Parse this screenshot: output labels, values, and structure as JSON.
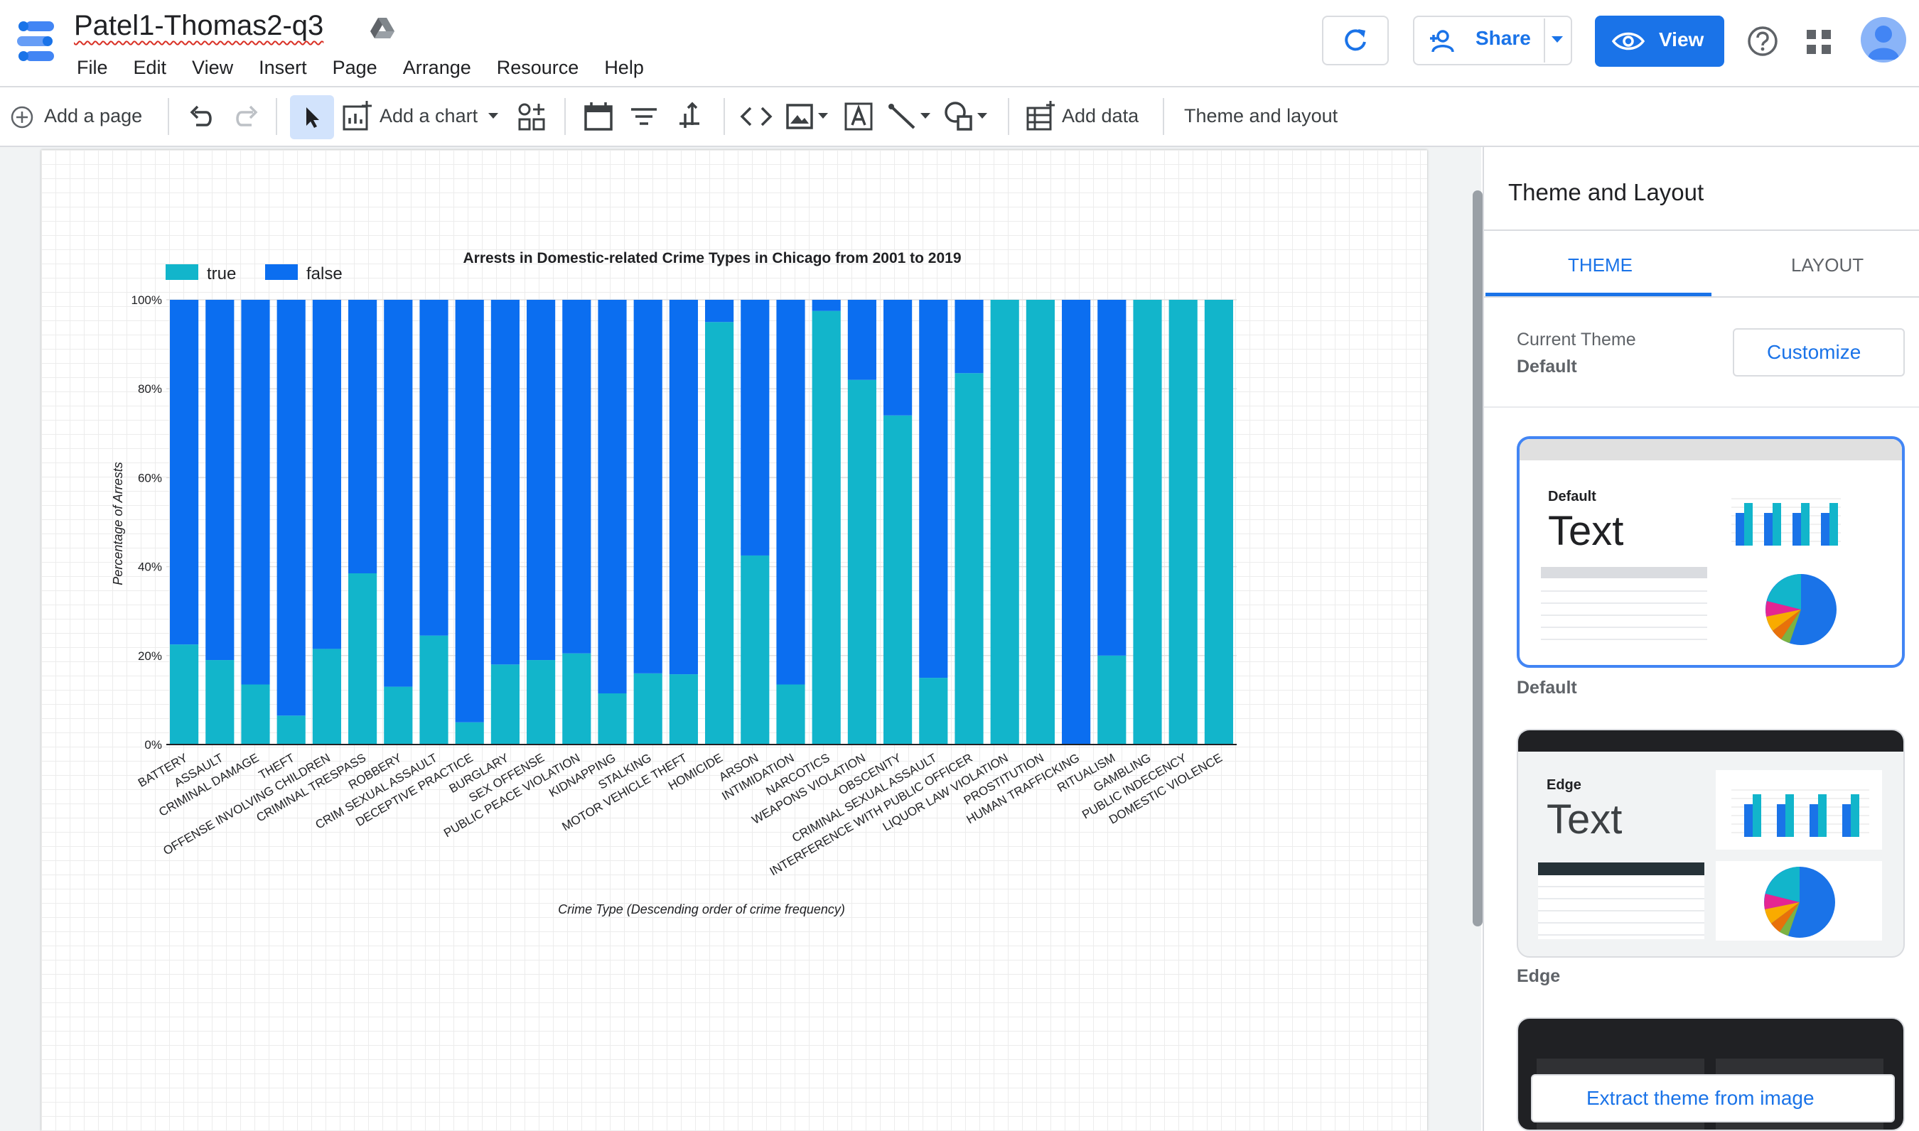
{
  "document": {
    "title": "Patel1-Thomas2-q3"
  },
  "menu": [
    "File",
    "Edit",
    "View",
    "Insert",
    "Page",
    "Arrange",
    "Resource",
    "Help"
  ],
  "header": {
    "share_label": "Share",
    "view_label": "View"
  },
  "toolbar": {
    "add_page": "Add a page",
    "add_chart": "Add a chart",
    "add_data": "Add data",
    "theme_layout": "Theme and layout"
  },
  "panel": {
    "title": "Theme and Layout",
    "tabs": [
      "THEME",
      "LAYOUT"
    ],
    "current_theme_label": "Current Theme",
    "current_theme_value": "Default",
    "customize_label": "Customize",
    "themes": [
      {
        "caption": "Default",
        "heading": "Default",
        "sample": "Text"
      },
      {
        "caption": "Edge",
        "heading": "Edge",
        "sample": "Text"
      }
    ],
    "extract_label": "Extract theme from image"
  },
  "colors": {
    "accent": "#1a73e8",
    "series_true": "#12b5cb",
    "series_false": "#0b6ef0"
  },
  "chart_data": {
    "type": "bar",
    "stacked": true,
    "title": "Arrests in Domestic-related Crime Types in Chicago from 2001 to 2019",
    "xlabel": "Crime Type (Descending order of crime frequency)",
    "ylabel": "Percentage of Arrests",
    "ylim": [
      0,
      100
    ],
    "yticks": [
      "0%",
      "20%",
      "40%",
      "60%",
      "80%",
      "100%"
    ],
    "legend_position": "top-left",
    "categories": [
      "BATTERY",
      "ASSAULT",
      "CRIMINAL DAMAGE",
      "THEFT",
      "OFFENSE INVOLVING CHILDREN",
      "CRIMINAL TRESPASS",
      "ROBBERY",
      "CRIM SEXUAL ASSAULT",
      "DECEPTIVE PRACTICE",
      "BURGLARY",
      "SEX OFFENSE",
      "PUBLIC PEACE VIOLATION",
      "KIDNAPPING",
      "STALKING",
      "MOTOR VEHICLE THEFT",
      "HOMICIDE",
      "ARSON",
      "INTIMIDATION",
      "NARCOTICS",
      "WEAPONS VIOLATION",
      "OBSCENITY",
      "CRIMINAL SEXUAL ASSAULT",
      "INTERFERENCE WITH PUBLIC OFFICER",
      "LIQUOR LAW VIOLATION",
      "PROSTITUTION",
      "HUMAN TRAFFICKING",
      "RITUALISM",
      "GAMBLING",
      "PUBLIC INDECENCY",
      "DOMESTIC VIOLENCE"
    ],
    "series": [
      {
        "name": "true",
        "values": [
          22.5,
          19,
          13.5,
          6.5,
          21.5,
          38.5,
          13,
          24.5,
          5,
          18,
          19,
          20.5,
          11.5,
          16,
          15.8,
          95,
          42.5,
          13.5,
          97.5,
          82,
          74,
          15,
          83.5,
          100,
          100,
          0,
          20,
          100,
          100,
          100
        ]
      },
      {
        "name": "false",
        "values": [
          77.5,
          81,
          86.5,
          93.5,
          78.5,
          61.5,
          87,
          75.5,
          95,
          82,
          81,
          79.5,
          88.5,
          84,
          84.2,
          5,
          57.5,
          86.5,
          2.5,
          18,
          26,
          85,
          16.5,
          0,
          0,
          100,
          80,
          0,
          0,
          0
        ]
      }
    ]
  }
}
